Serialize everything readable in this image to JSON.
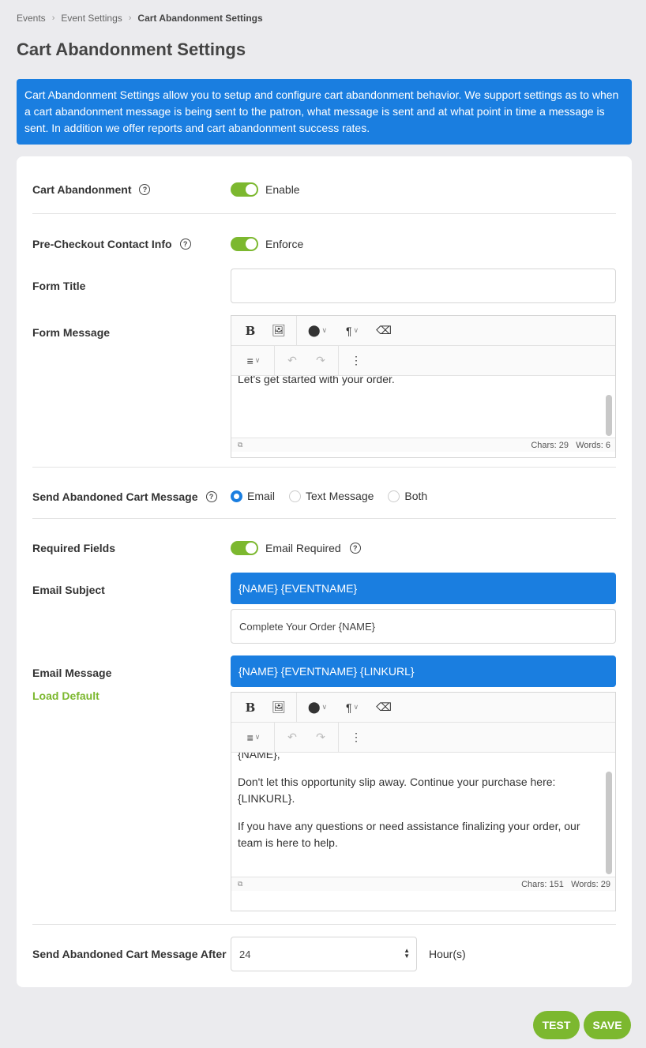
{
  "breadcrumb": {
    "items": [
      "Events",
      "Event Settings"
    ],
    "current": "Cart Abandonment Settings"
  },
  "page": {
    "title": "Cart Abandonment Settings",
    "info": "Cart Abandonment Settings allow you to setup and configure cart abandonment behavior. We support settings as to when a cart abandonment message is being sent to the patron, what message is sent and at what point in time a message is sent. In addition we offer reports and cart abandonment success rates."
  },
  "cart_abandonment": {
    "label": "Cart Abandonment",
    "toggle_label": "Enable",
    "enabled": true
  },
  "pre_checkout": {
    "label": "Pre-Checkout Contact Info",
    "toggle_label": "Enforce",
    "enabled": true
  },
  "form_title": {
    "label": "Form Title",
    "value": ""
  },
  "form_message": {
    "label": "Form Message",
    "content": "Let's get started with your order.",
    "chars": "Chars: 29",
    "words": "Words: 6"
  },
  "send_message": {
    "label": "Send Abandoned Cart Message",
    "options": [
      "Email",
      "Text Message",
      "Both"
    ],
    "selected": "Email"
  },
  "required_fields": {
    "label": "Required Fields",
    "toggle_label": "Email Required",
    "enabled": true
  },
  "email_subject": {
    "label": "Email Subject",
    "tags": "{NAME} {EVENTNAME}",
    "value": "Complete Your Order {NAME}"
  },
  "email_message": {
    "label": "Email Message",
    "load_default": "Load Default",
    "tags": "{NAME} {EVENTNAME} {LINKURL}",
    "paragraphs": [
      "{NAME},",
      "Don't let this opportunity slip away. Continue your purchase here: {LINKURL}.",
      "If you have any questions or need assistance finalizing your order, our team is here to help."
    ],
    "chars": "Chars: 151",
    "words": "Words: 29"
  },
  "send_after": {
    "label": "Send Abandoned Cart Message After",
    "value": "24",
    "unit": "Hour(s)"
  },
  "actions": {
    "test": "TEST",
    "save": "SAVE"
  },
  "colors": {
    "primary": "#1a7ee0",
    "accent": "#7cb82f"
  }
}
